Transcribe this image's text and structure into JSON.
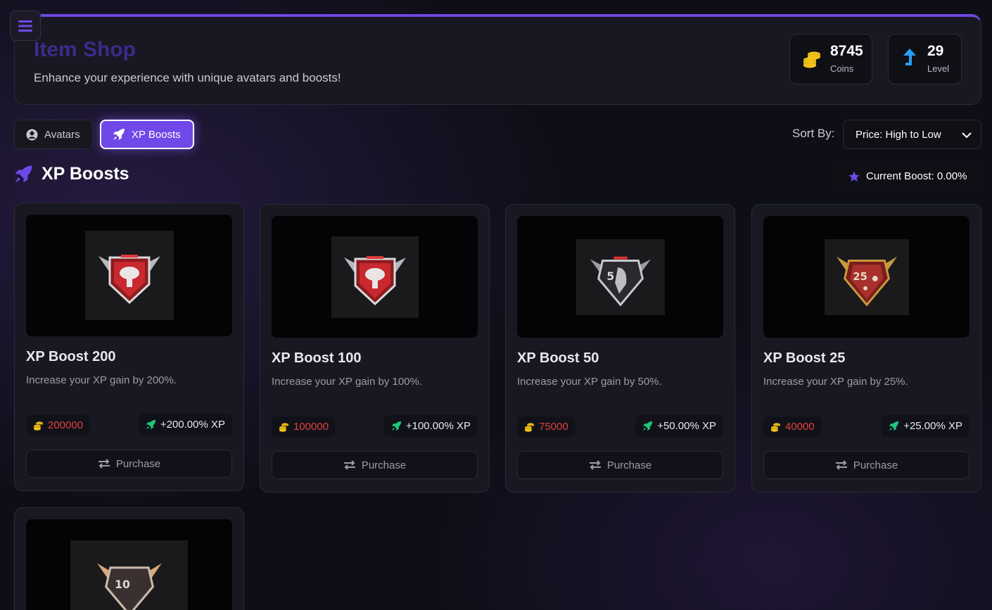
{
  "header": {
    "title": "Item Shop",
    "subtitle": "Enhance your experience with unique avatars and boosts!",
    "coins": {
      "value": "8745",
      "label": "Coins"
    },
    "level": {
      "value": "29",
      "label": "Level"
    }
  },
  "tabs": [
    {
      "label": "Avatars",
      "icon": "user-circle-icon",
      "active": false
    },
    {
      "label": "XP Boosts",
      "icon": "rocket-icon",
      "active": true
    }
  ],
  "sort": {
    "label": "Sort By:",
    "selected": "Price: High to Low"
  },
  "section": {
    "title": "XP Boosts",
    "current_boost": "Current Boost: 0.00%"
  },
  "items": [
    {
      "name": "XP Boost 200",
      "description": "Increase your XP gain by 200%.",
      "price": "200000",
      "xp": "+200.00% XP",
      "button": "Purchase",
      "emblem": "red-nuke-emblem"
    },
    {
      "name": "XP Boost 100",
      "description": "Increase your XP gain by 100%.",
      "price": "100000",
      "xp": "+100.00% XP",
      "button": "Purchase",
      "emblem": "red-nuke-emblem"
    },
    {
      "name": "XP Boost 50",
      "description": "Increase your XP gain by 50%.",
      "price": "75000",
      "xp": "+50.00% XP",
      "button": "Purchase",
      "emblem": "silver-reaper-emblem"
    },
    {
      "name": "XP Boost 25",
      "description": "Increase your XP gain by 25%.",
      "price": "40000",
      "xp": "+25.00% XP",
      "button": "Purchase",
      "emblem": "gold-red-emblem"
    },
    {
      "emblem": "bronze-emblem"
    }
  ],
  "colors": {
    "accent": "#7048e8",
    "price": "#e2403e",
    "xp_icon": "#1ec77a",
    "coin": "#f2c21b",
    "level_icon": "#2a9df4"
  }
}
